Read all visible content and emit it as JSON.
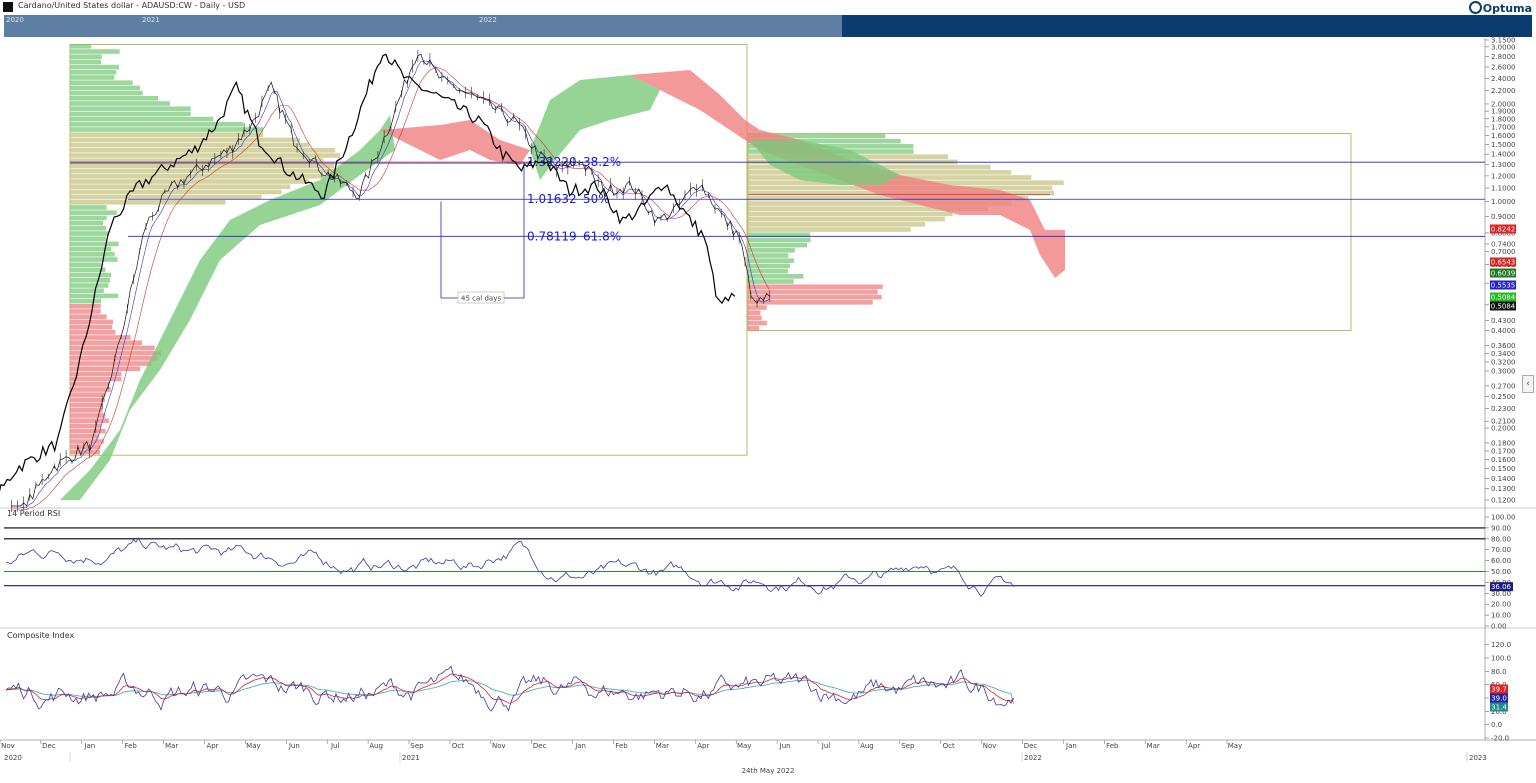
{
  "header": {
    "title": "Cardano/United States dollar - ADAUSD:CW - Daily - USD",
    "brand": "Optuma"
  },
  "navigator": {
    "years": [
      "2020",
      "2021",
      "2022"
    ]
  },
  "footer": {
    "date_label": "24th May 2022"
  },
  "colors": {
    "price": "#111111",
    "tenkan": "#3333cc",
    "kijun": "#cc3333",
    "cloud_bull": "#7cc97c",
    "cloud_bear": "#f08080",
    "vp_khaki": "#c8c484",
    "vp_green": "#7cc97c",
    "vp_red": "#f08080",
    "fib": "#2222cc",
    "rsi": "#3a3aa8",
    "rsi_mid": "#2a8a2a",
    "ci": "#3a3aa8",
    "ci_fast": "#dd2222",
    "ci_slow": "#33aaaa"
  },
  "chart_data": [
    {
      "type": "line",
      "title": "Cardano/United States dollar - ADAUSD:CW - Daily - USD",
      "scale": "log",
      "ylim": [
        0.115,
        3.15
      ],
      "y_ticks": [
        "3.1500",
        "3.0000",
        "2.8000",
        "2.6000",
        "2.4000",
        "2.2000",
        "2.0000",
        "1.9000",
        "1.8000",
        "1.7000",
        "1.6000",
        "1.5000",
        "1.4000",
        "1.3000",
        "1.2000",
        "1.1000",
        "1.0000",
        "0.9000",
        "0.8000",
        "0.7400",
        "0.7000",
        "0.6400",
        "0.5600",
        "0.4800",
        "0.4300",
        "0.4000",
        "0.3600",
        "0.3400",
        "0.3200",
        "0.3000",
        "0.2700",
        "0.2500",
        "0.2300",
        "0.2100",
        "0.2000",
        "0.1800",
        "0.1700",
        "0.1600",
        "0.1500",
        "0.1400",
        "0.1300",
        "0.1200"
      ],
      "x_ticks": [
        "Nov",
        "Dec",
        "Jan",
        "Feb",
        "Mar",
        "Apr",
        "May",
        "Jun",
        "Jul",
        "Aug",
        "Sep",
        "Oct",
        "Nov",
        "Dec",
        "Jan",
        "Feb",
        "Mar",
        "Apr",
        "May",
        "Jun",
        "Jul",
        "Aug",
        "Sep",
        "Oct",
        "Nov",
        "Dec",
        "Jan",
        "Feb",
        "Mar",
        "Apr",
        "May"
      ],
      "x_years": [
        "2020",
        "2021",
        "2022",
        "2023"
      ],
      "series": [
        {
          "values_date": [
            "2020-11-01",
            "2020-12-01",
            "2021-01-01",
            "2021-01-20",
            "2021-02-10",
            "2021-03-01",
            "2021-03-20",
            "2021-04-14",
            "2021-05-01",
            "2021-05-15",
            "2021-06-01",
            "2021-06-22",
            "2021-07-20",
            "2021-08-10",
            "2021-08-25",
            "2021-09-02",
            "2021-09-20",
            "2021-10-10",
            "2021-10-28",
            "2021-11-15",
            "2021-12-01",
            "2021-12-15",
            "2022-01-01",
            "2022-01-20",
            "2022-02-10",
            "2022-03-01",
            "2022-03-15",
            "2022-04-01",
            "2022-04-20",
            "2022-05-01",
            "2022-05-12",
            "2022-05-24"
          ],
          "values": [
            0.1,
            0.15,
            0.18,
            0.35,
            0.85,
            1.1,
            1.25,
            1.45,
            1.75,
            2.25,
            1.55,
            1.25,
            1.05,
            1.65,
            2.4,
            2.95,
            2.35,
            2.15,
            1.95,
            1.75,
            1.4,
            1.25,
            1.35,
            1.08,
            1.12,
            0.87,
            0.95,
            1.15,
            0.88,
            0.78,
            0.48,
            0.51
          ]
        },
        {
          "last_close": "0.5084"
        }
      ],
      "fib_levels": [
        {
          "price": "1.32220",
          "pct": "38.2%"
        },
        {
          "price": "1.01632",
          "pct": "50%"
        },
        {
          "price": "0.78119",
          "pct": "61.8%"
        }
      ],
      "annotation": "45 cal days",
      "price_labels": [
        {
          "value": "0.8242",
          "color": "#dd2222"
        },
        {
          "value": "0.6543",
          "color": "#dd2222"
        },
        {
          "value": "0.6039",
          "color": "#1f7a1f"
        },
        {
          "value": "0.5535",
          "color": "#2222cc"
        },
        {
          "value": "0.5084",
          "color": "#22bb22"
        },
        {
          "value": "0.5084",
          "color": "#111111"
        }
      ]
    },
    {
      "type": "line",
      "title": "14 Period RSI",
      "ylim": [
        0,
        100
      ],
      "y_ticks": [
        "100.00",
        "90.00",
        "80.00",
        "70.00",
        "60.00",
        "50.00",
        "40.00",
        "30.00",
        "20.00",
        "10.00",
        "0.00"
      ],
      "reference_lines": [
        90,
        80,
        50,
        37
      ],
      "last_value": "36.06"
    },
    {
      "type": "line",
      "title": "Composite Index",
      "ylim": [
        -20,
        130
      ],
      "y_ticks": [
        "120.0",
        "100.0",
        "80.0",
        "60.0",
        "40.0",
        "20.0",
        "0.0",
        "-20.0"
      ],
      "last_values": [
        {
          "value": "39.7",
          "color": "#dd2222"
        },
        {
          "value": "39.0",
          "color": "#2222aa"
        },
        {
          "value": "31.4",
          "color": "#1f8a8a"
        }
      ]
    }
  ]
}
